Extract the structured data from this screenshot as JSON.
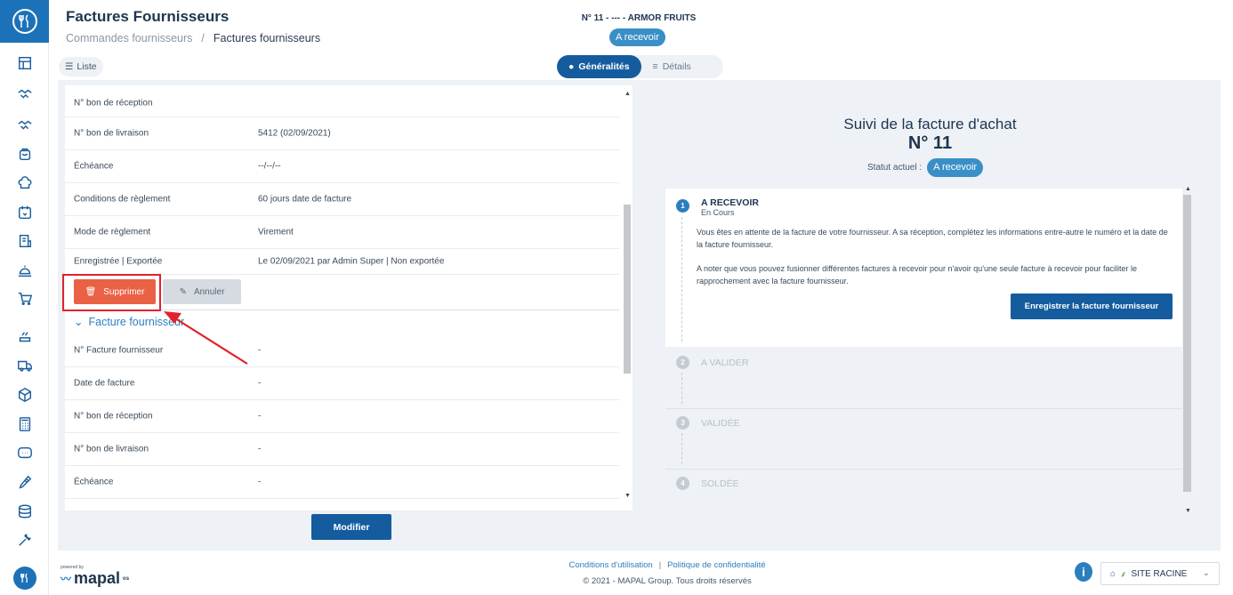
{
  "header": {
    "title": "Factures Fournisseurs",
    "breadcrumb": [
      "Commandes fournisseurs",
      "Factures fournisseurs"
    ],
    "invoice_ref": "N° 11 - --- - ARMOR FRUITS",
    "status": "A recevoir"
  },
  "toolbar": {
    "list_label": "Liste",
    "tabs": [
      {
        "label": "Généralités",
        "active": true
      },
      {
        "label": "Détails",
        "active": false
      }
    ]
  },
  "left_panel": {
    "rows_top": [
      {
        "label": "N° bon de réception",
        "value": ""
      },
      {
        "label": "N° bon de livraison",
        "value": "5412  (02/09/2021)"
      },
      {
        "label": "Échéance",
        "value": "--/--/--"
      },
      {
        "label": "Conditions de règlement",
        "value": "60 jours date de facture"
      },
      {
        "label": "Mode de règlement",
        "value": "Virement"
      },
      {
        "label": "Enregistrée | Exportée",
        "value": "Le 02/09/2021 par Admin Super | Non exportée"
      }
    ],
    "delete_label": "Supprimer",
    "cancel_label": "Annuler",
    "section_title": "Facture fournisseur",
    "rows_bottom": [
      {
        "label": "N° Facture fournisseur",
        "value": "-"
      },
      {
        "label": "Date de facture",
        "value": "-"
      },
      {
        "label": "N° bon de réception",
        "value": "-"
      },
      {
        "label": "N° bon de livraison",
        "value": "-"
      },
      {
        "label": "Échéance",
        "value": "-"
      }
    ],
    "modify_label": "Modifier"
  },
  "right_panel": {
    "title": "Suivi de la facture d'achat",
    "number": "N° 11",
    "status_label": "Statut actuel :",
    "status_value": "A recevoir",
    "steps": [
      {
        "num": "1",
        "title": "A RECEVOIR",
        "subtitle": "En Cours",
        "text1": "Vous êtes en attente de la facture de votre fournisseur. A sa réception, complétez les informations entre-autre le numéro et la date de la facture fournisseur.",
        "text2": "A noter que vous pouvez fusionner différentes factures à recevoir pour n'avoir qu'une seule facture à recevoir pour faciliter le rapprochement avec la facture fournisseur.",
        "button": "Enregistrer la facture fournisseur"
      },
      {
        "num": "2",
        "title": "A VALIDER"
      },
      {
        "num": "3",
        "title": "VALIDÉE"
      },
      {
        "num": "4",
        "title": "SOLDÉE"
      }
    ]
  },
  "footer": {
    "powered_by": "powered by",
    "brand": "mapal",
    "brand_suffix": "os",
    "link_terms": "Conditions d'utilisation",
    "link_privacy": "Politique de confidentialité",
    "copyright": "© 2021 - MAPAL Group. Tous droits réservés",
    "site": "SITE RACINE"
  },
  "colors": {
    "primary": "#145c9e",
    "accent": "#3a8fc6",
    "danger": "#ea6145",
    "highlight": "#e2222b"
  },
  "icons": [
    "home-icon",
    "dashboard-icon",
    "handshake-icon",
    "bag-icon",
    "chef-hat-icon",
    "calendar-heart-icon",
    "invoice-icon",
    "cloche-icon",
    "cart-icon",
    "kitchen-icon",
    "truck-icon",
    "box-icon",
    "calculator-icon",
    "chat-icon",
    "wrench-icon",
    "database-icon",
    "tools-icon"
  ]
}
